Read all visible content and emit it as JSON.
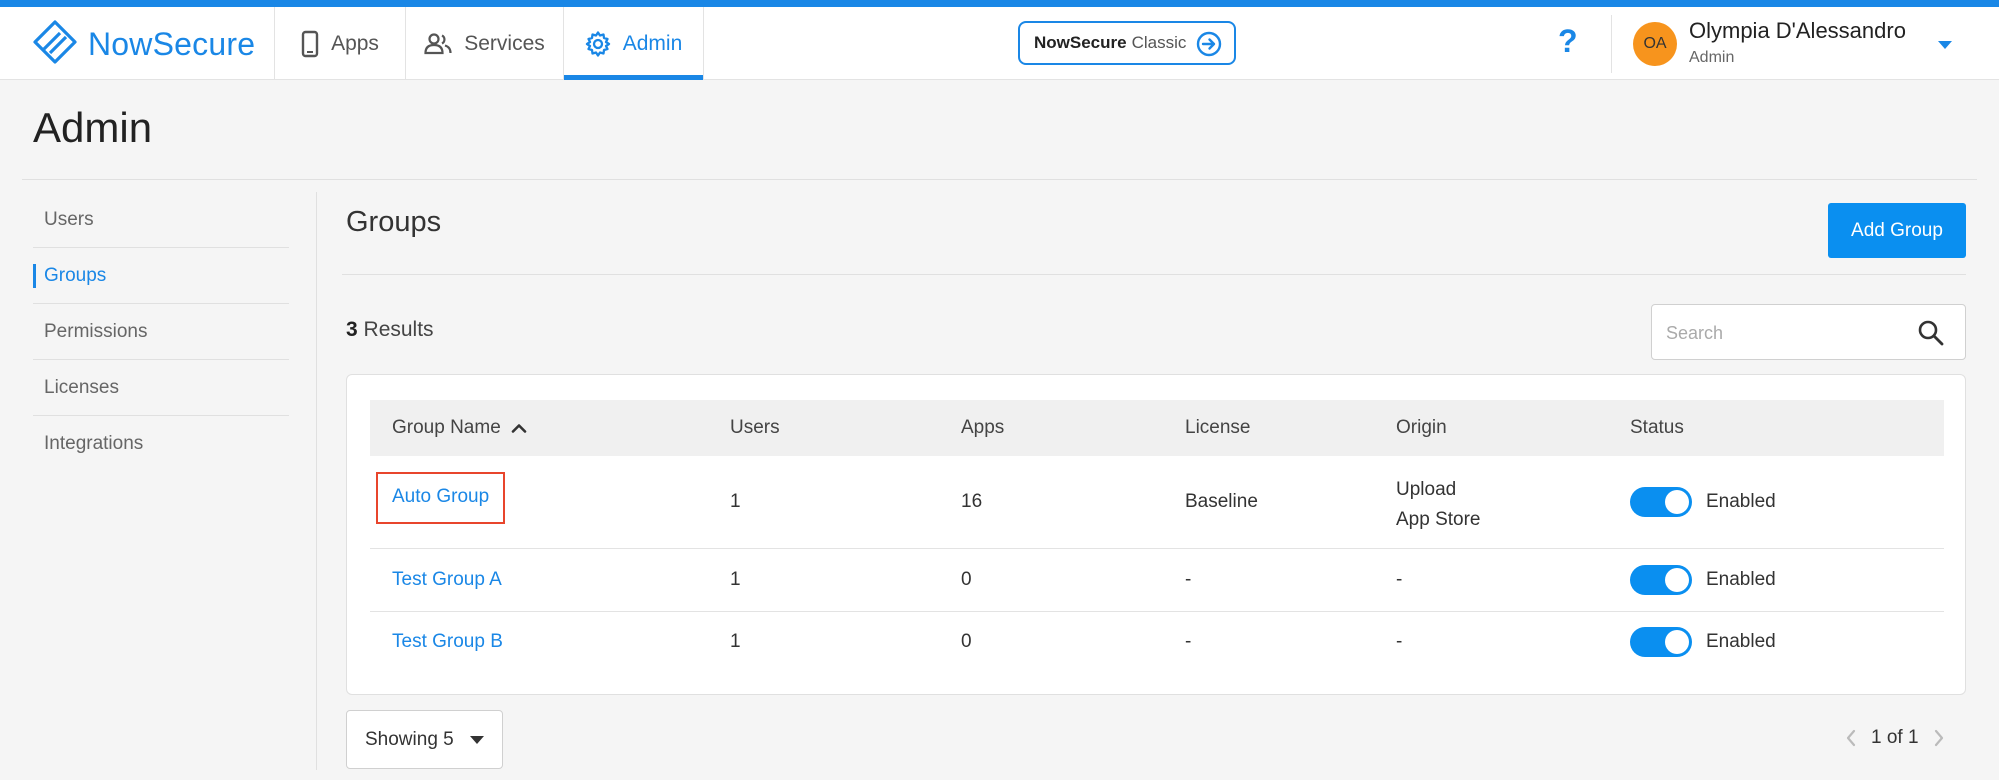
{
  "app": {
    "logo_text": "NowSecure",
    "accent": "#1a87e6"
  },
  "nav": {
    "tabs": [
      {
        "label": "Apps",
        "icon": "phone-icon"
      },
      {
        "label": "Services",
        "icon": "people-icon"
      },
      {
        "label": "Admin",
        "icon": "gear-icon",
        "active": true
      }
    ]
  },
  "classic_button": {
    "brand": "NowSecure",
    "suffix": "Classic"
  },
  "help": {
    "label": "?"
  },
  "user": {
    "initials": "OA",
    "name": "Olympia D'Alessandro",
    "role": "Admin"
  },
  "page": {
    "title": "Admin"
  },
  "sidebar": {
    "items": [
      {
        "label": "Users"
      },
      {
        "label": "Groups",
        "active": true
      },
      {
        "label": "Permissions"
      },
      {
        "label": "Licenses"
      },
      {
        "label": "Integrations"
      }
    ]
  },
  "groups": {
    "title": "Groups",
    "add_button": "Add Group",
    "results_count": "3",
    "results_label": "Results",
    "search_placeholder": "Search",
    "columns": [
      "Group Name",
      "Users",
      "Apps",
      "License",
      "Origin",
      "Status"
    ],
    "rows": [
      {
        "name": "Auto Group",
        "users": "1",
        "apps": "16",
        "license": "Baseline",
        "origin": [
          "Upload",
          "App Store"
        ],
        "status": "Enabled"
      },
      {
        "name": "Test Group A",
        "users": "1",
        "apps": "0",
        "license": "-",
        "origin": [
          "-"
        ],
        "status": "Enabled"
      },
      {
        "name": "Test Group B",
        "users": "1",
        "apps": "0",
        "license": "-",
        "origin": [
          "-"
        ],
        "status": "Enabled"
      }
    ]
  },
  "footer": {
    "showing": "Showing 5",
    "page_info": "1 of 1"
  }
}
